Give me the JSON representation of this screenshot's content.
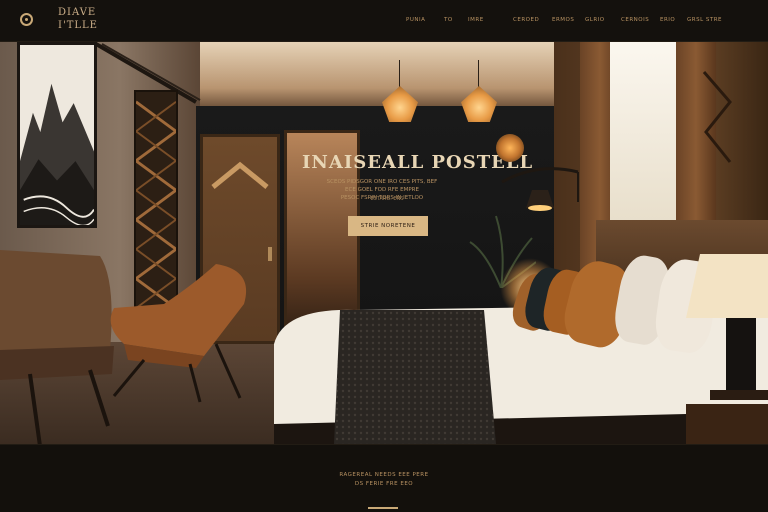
{
  "brand": {
    "logo_line1": "DIAVE",
    "logo_line2": "I'TLLE"
  },
  "nav": {
    "items": [
      "PUNIA",
      "TO",
      "IMRE",
      "CEROED",
      "ERMOS",
      "GLRIO",
      "CERNOIS",
      "ERIO",
      "GRSL STRE"
    ]
  },
  "hero": {
    "title": "INAISEALL POSTELL",
    "subtitle_line1": "SCEOS PIDSGOR ONE IRO CES PITS, BEF",
    "subtitle_line2": "ECE GOEL FOD  RFE EMPRE",
    "subtitle_line3": "PESOC FSRIN TORS IN IETLOO",
    "small_text": "ESTARG. ENS",
    "cta_label": "STRIE NORETENE"
  },
  "footer": {
    "line1": "RAGEREAL NEEDS EEE PERE",
    "line2": "DS FERIE FRE EEO"
  },
  "colors": {
    "accent": "#c9a977",
    "cta": "#d9b784",
    "background": "#0f0d0a"
  }
}
